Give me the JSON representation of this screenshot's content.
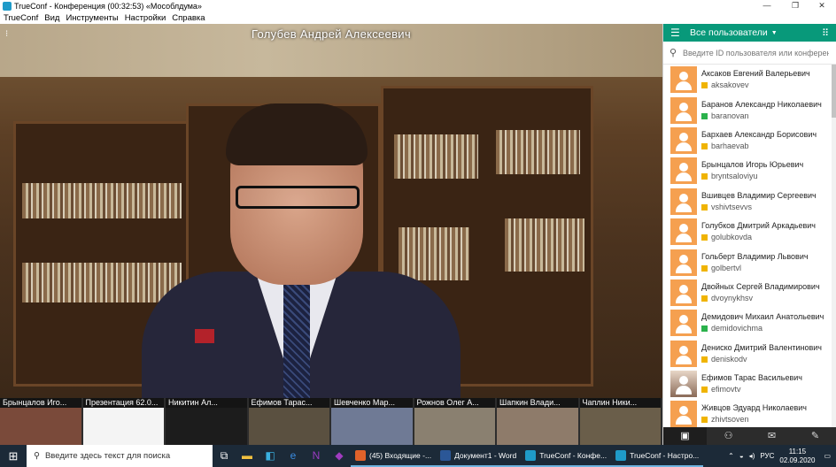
{
  "window": {
    "title": "TrueConf - Конференция (00:32:53) «Мособлдума»",
    "minimize": "—",
    "maximize": "❐",
    "close": "✕"
  },
  "menu": [
    "TrueConf",
    "Вид",
    "Инструменты",
    "Настройки",
    "Справка"
  ],
  "video": {
    "speaker_name": "Голубев Андрей Алексеевич"
  },
  "thumbnails": [
    {
      "label": "Брынцалов Иго...",
      "color": "#7a4a3a"
    },
    {
      "label": "Презентация 62.0...",
      "color": "#f4f4f4"
    },
    {
      "label": "Никитин Ал...",
      "color": "#1c1c1c"
    },
    {
      "label": "Ефимов Тарас...",
      "color": "#5a5040"
    },
    {
      "label": "Шевченко Мар...",
      "color": "#6f7a95"
    },
    {
      "label": "Рожнов Олег А...",
      "color": "#8a8070"
    },
    {
      "label": "Шапкин Влади...",
      "color": "#8e7b6a"
    },
    {
      "label": "Чаплин Ники...",
      "color": "#6a5e4a"
    }
  ],
  "panel": {
    "title": "Все пользователи",
    "search_placeholder": "Введите ID пользователя или конференции"
  },
  "users": [
    {
      "name": "Аксаков Евгений Валерьевич",
      "login": "aksakovev",
      "status": "#f0b400",
      "photo": false
    },
    {
      "name": "Баранов Александр Николаевич",
      "login": "baranovan",
      "status": "#2bb24c",
      "photo": false
    },
    {
      "name": "Бархаев Александр Борисович",
      "login": "barhaevab",
      "status": "#f0b400",
      "photo": false
    },
    {
      "name": "Брынцалов Игорь Юрьевич",
      "login": "bryntsaloviyu",
      "status": "#f0b400",
      "photo": false
    },
    {
      "name": "Вшивцев Владимир Сергеевич",
      "login": "vshivtsevvs",
      "status": "#f0b400",
      "photo": false
    },
    {
      "name": "Голубков Дмитрий Аркадьевич",
      "login": "golubkovda",
      "status": "#f0b400",
      "photo": false
    },
    {
      "name": "Гольберт Владимир Львович",
      "login": "golbertvl",
      "status": "#f0b400",
      "photo": false
    },
    {
      "name": "Двойных Сергей Владимирович",
      "login": "dvoynykhsv",
      "status": "#f0b400",
      "photo": false
    },
    {
      "name": "Демидович Михаил Анатольевич",
      "login": "demidovichma",
      "status": "#2bb24c",
      "photo": false
    },
    {
      "name": "Дениско Дмитрий Валентинович",
      "login": "deniskodv",
      "status": "#f0b400",
      "photo": false
    },
    {
      "name": "Ефимов Тарас Васильевич",
      "login": "efimovtv",
      "status": "#f0b400",
      "photo": true
    },
    {
      "name": "Живцов Эдуард Николаевич",
      "login": "zhivtsoven",
      "status": "#f0b400",
      "photo": false
    }
  ],
  "taskbar": {
    "search_placeholder": "Введите здесь текст для поиска",
    "apps": [
      {
        "label": "(45) Входящие -...",
        "color": "#e0622a"
      },
      {
        "label": "Документ1 - Word",
        "color": "#2b5797"
      },
      {
        "label": "TrueConf - Конфе...",
        "color": "#1f9bc9"
      },
      {
        "label": "TrueConf - Настро...",
        "color": "#1f9bc9"
      }
    ],
    "lang": "РУС",
    "time": "11:15",
    "date": "02.09.2020"
  }
}
